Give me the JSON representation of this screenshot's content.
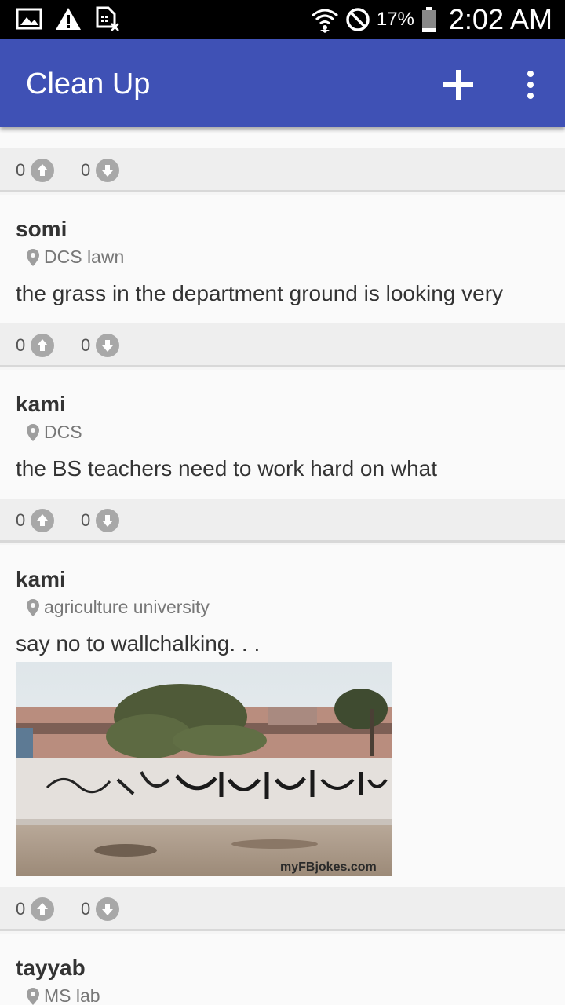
{
  "status_bar": {
    "battery": "17%",
    "time": "2:02 AM"
  },
  "app_bar": {
    "title": "Clean Up"
  },
  "posts": [
    {
      "author": "",
      "location": "",
      "text": "",
      "upvotes": "0",
      "downvotes": "0"
    },
    {
      "author": "somi",
      "location": "DCS lawn",
      "text": "the grass in the department ground is looking very",
      "upvotes": "0",
      "downvotes": "0"
    },
    {
      "author": "kami",
      "location": "DCS",
      "text": "the BS teachers need to work hard on what",
      "upvotes": "0",
      "downvotes": "0"
    },
    {
      "author": "kami",
      "location": "agriculture university",
      "text": "say no to wallchalking. . .",
      "image_watermark": "myFBjokes.com",
      "upvotes": "0",
      "downvotes": "0"
    },
    {
      "author": "tayyab",
      "location": "MS lab",
      "text": ""
    }
  ]
}
